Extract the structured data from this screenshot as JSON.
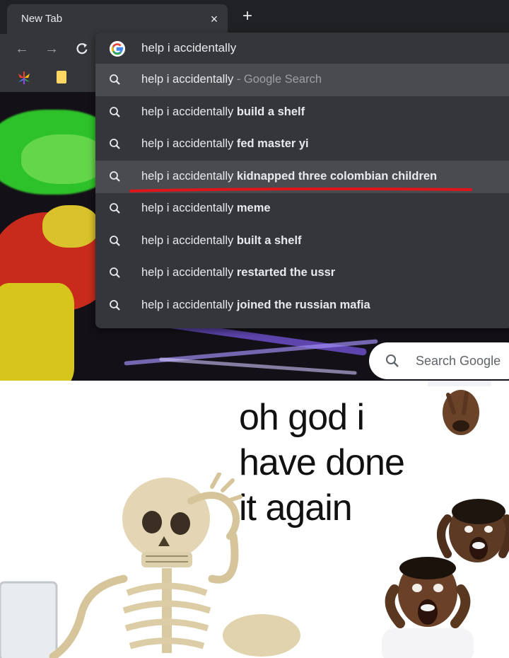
{
  "browser": {
    "tab_title": "New Tab",
    "tab_close": "×",
    "new_tab": "+",
    "nav": {
      "back": "←",
      "forward": "→",
      "reload": "C"
    }
  },
  "omnibox": {
    "input_text": "help i accidentally",
    "suggestions": [
      {
        "prefix": "help i accidentally",
        "completion": "",
        "sep": " - ",
        "suffix": "Google Search",
        "highlighted": true,
        "underlined": false
      },
      {
        "prefix": "help i accidentally",
        "completion": "build a shelf",
        "highlighted": false,
        "underlined": false
      },
      {
        "prefix": "help i accidentally",
        "completion": "fed master yi",
        "highlighted": false,
        "underlined": false
      },
      {
        "prefix": "help i accidentally",
        "completion": "kidnapped three colombian children",
        "highlighted": true,
        "underlined": true
      },
      {
        "prefix": "help i accidentally",
        "completion": "meme",
        "highlighted": false,
        "underlined": false
      },
      {
        "prefix": "help i accidentally",
        "completion": "built a shelf",
        "highlighted": false,
        "underlined": false
      },
      {
        "prefix": "help i accidentally",
        "completion": "restarted the ussr",
        "highlighted": false,
        "underlined": false
      },
      {
        "prefix": "help i accidentally",
        "completion": "joined the russian mafia",
        "highlighted": false,
        "underlined": false
      }
    ]
  },
  "search_pill": {
    "label": "Search Google"
  },
  "meme": {
    "caption_lines": [
      "oh god i",
      "have done",
      "it again"
    ]
  },
  "colors": {
    "browser_bg": "#202124",
    "toolbar": "#35363a",
    "highlight_row": "#4a4b4f",
    "underline": "#e0141b"
  }
}
